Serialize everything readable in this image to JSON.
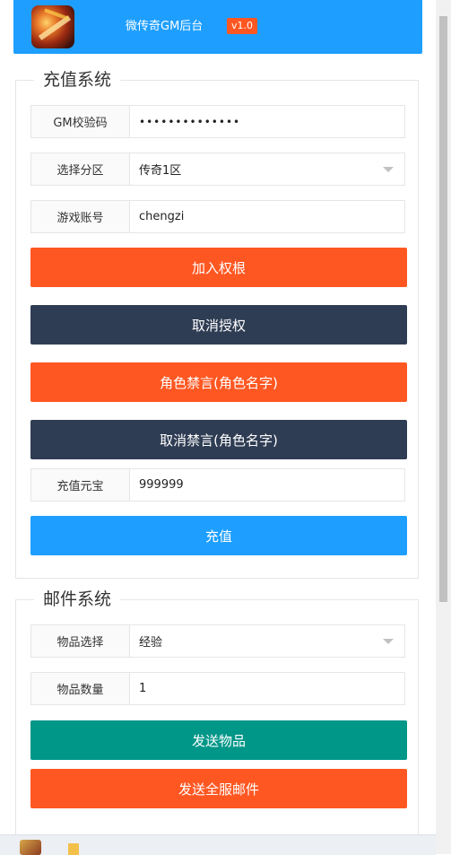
{
  "header": {
    "title": "微传奇GM后台",
    "version": "v1.0"
  },
  "recharge": {
    "legend": "充值系统",
    "gm_code": {
      "label": "GM校验码",
      "value": "••••••••••••••"
    },
    "zone": {
      "label": "选择分区",
      "value": "传奇1区"
    },
    "account": {
      "label": "游戏账号",
      "value": "chengzi"
    },
    "btn_grant": "加入权根",
    "btn_revoke": "取消授权",
    "btn_mute": "角色禁言(角色名字)",
    "btn_unmute": "取消禁言(角色名字)",
    "amount": {
      "label": "充值元宝",
      "value": "999999"
    },
    "btn_recharge": "充值"
  },
  "mail": {
    "legend": "邮件系统",
    "item": {
      "label": "物品选择",
      "value": "经验"
    },
    "qty": {
      "label": "物品数量",
      "value": "1"
    },
    "btn_send": "发送物品",
    "btn_send_all": "发送全服邮件"
  },
  "colors": {
    "primary": "#1e9fff",
    "warn": "#ff5722",
    "dark": "#2f3d54",
    "green": "#009688"
  }
}
